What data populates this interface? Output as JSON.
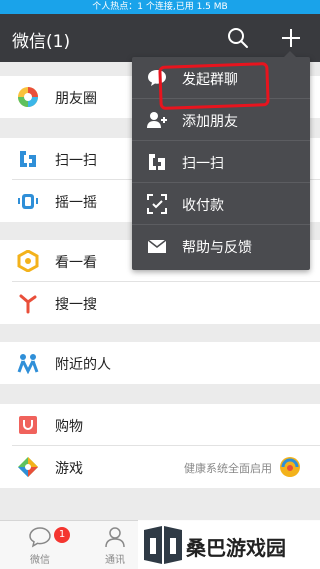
{
  "status": {
    "hotspot_text": "个人热点：1 个连接,已用 1.5 MB"
  },
  "header": {
    "title": "微信(1)",
    "search_icon": "search-icon",
    "add_icon": "plus-icon"
  },
  "list": {
    "moments": "朋友圈",
    "scan": "扫一扫",
    "shake": "摇一摇",
    "look": "看一看",
    "search": "搜一搜",
    "nearby": "附近的人",
    "shopping": "购物",
    "games": "游戏",
    "games_note": "健康系统全面启用"
  },
  "menu": {
    "items": [
      "发起群聊",
      "添加朋友",
      "扫一扫",
      "收付款",
      "帮助与反馈"
    ]
  },
  "tabs": {
    "chats": "微信",
    "contacts": "通讯",
    "chats_badge": "1"
  },
  "watermark": {
    "text": "桑巴游戏园"
  },
  "colors": {
    "header_bg": "#393a3e",
    "hotspot_bg": "#1aa3ea",
    "menu_bg": "#4a4b4f",
    "annotation": "#e8141e",
    "badge": "#f43530"
  }
}
